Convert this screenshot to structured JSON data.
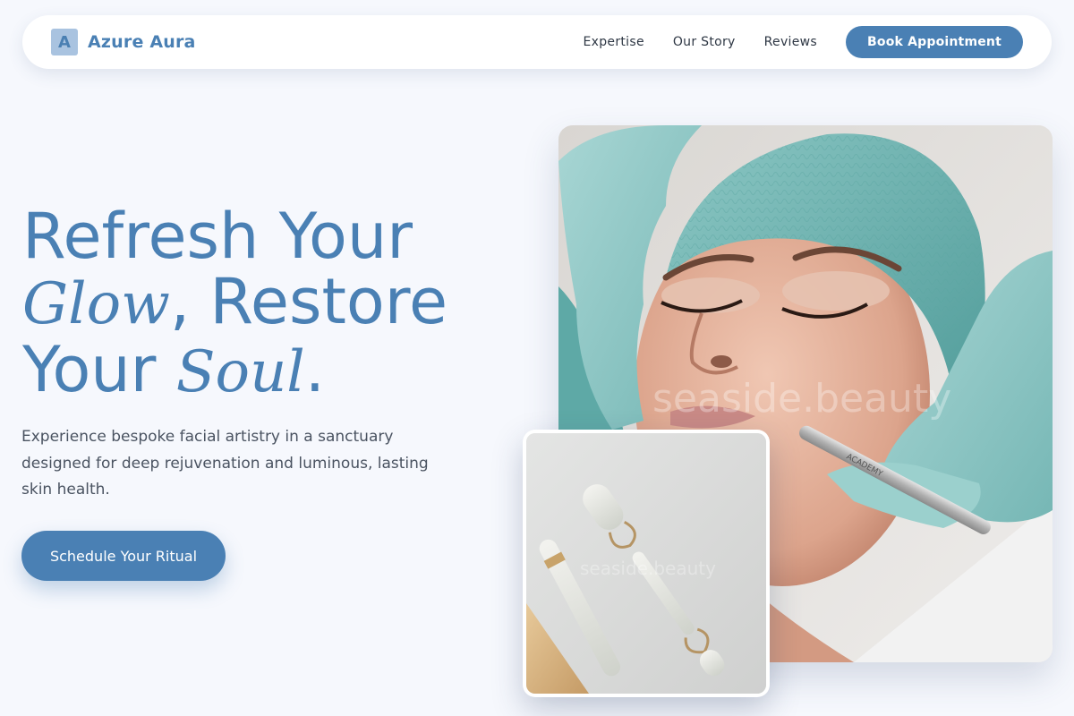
{
  "header": {
    "brand_initial": "A",
    "brand_name": "Azure Aura",
    "nav_links": [
      "Expertise",
      "Our Story",
      "Reviews"
    ],
    "cta_label": "Book Appointment"
  },
  "hero": {
    "title_line1": "Refresh Your",
    "title_glow": "Glow",
    "title_line2_rest": ", Restore",
    "title_line3_your": "Your ",
    "title_soul": "Soul",
    "title_period": ".",
    "subtitle": "Experience bespoke facial artistry in a sanctuary designed for deep rejuvenation and luminous, lasting skin health.",
    "cta_label": "Schedule Your Ritual"
  },
  "images": {
    "main_watermark": "seaside.beauty",
    "roller_watermark": "seaside.beauty",
    "tool_engraving": "ACADEMY"
  },
  "colors": {
    "accent": "#4a80b4",
    "page_background": "#f6f8fd",
    "glove": "#8fcac8",
    "cap": "#6fb3b0"
  }
}
